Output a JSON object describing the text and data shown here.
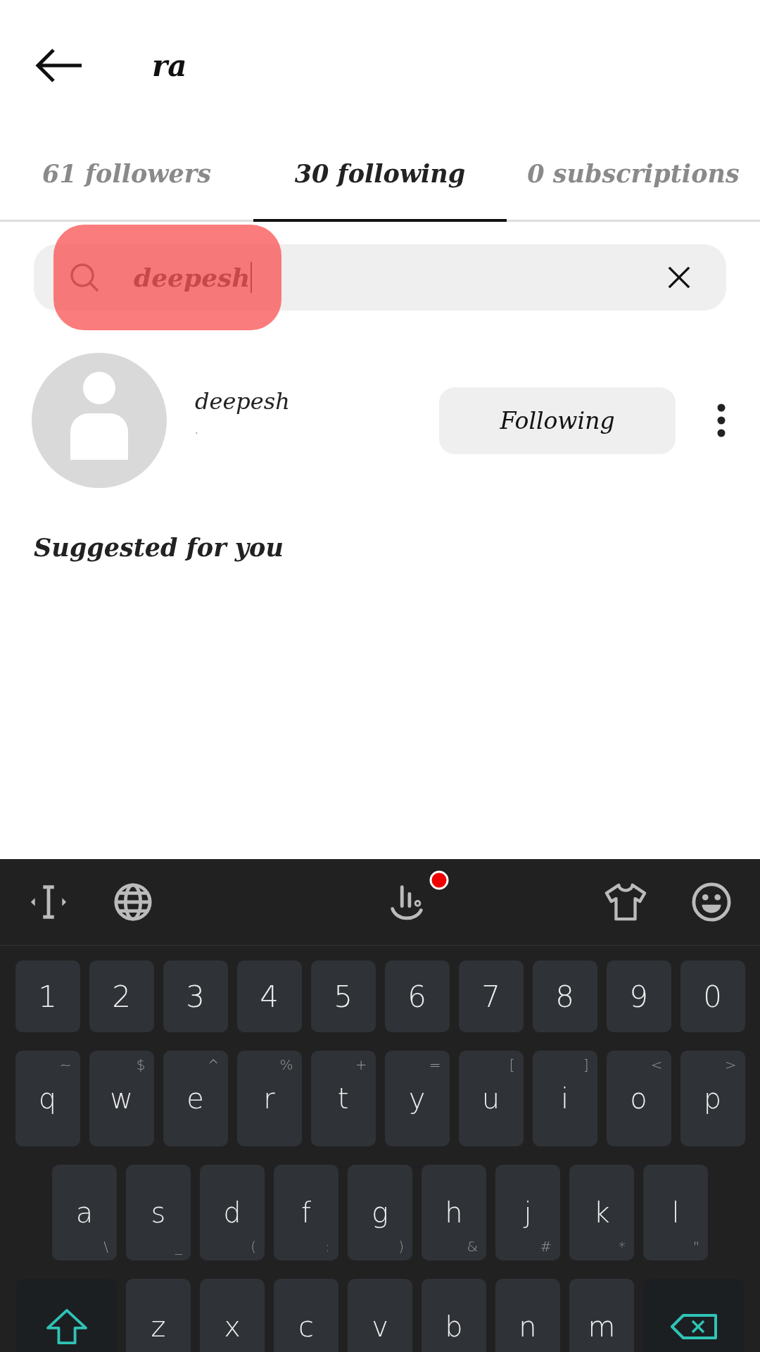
{
  "header": {
    "title": "ra"
  },
  "tabs": [
    {
      "label": "61 followers",
      "selected": false
    },
    {
      "label": "30 following",
      "selected": true
    },
    {
      "label": "0 subscriptions",
      "selected": false
    }
  ],
  "search": {
    "value": "deepesh",
    "highlighted": true
  },
  "results": [
    {
      "username": "deepesh",
      "subtitle": ".",
      "button": "Following"
    }
  ],
  "suggested": {
    "heading": "Suggested for you"
  },
  "keyboard": {
    "notification": true,
    "rows": [
      {
        "kind": "numbers",
        "keys": [
          {
            "label": "1"
          },
          {
            "label": "2"
          },
          {
            "label": "3"
          },
          {
            "label": "4"
          },
          {
            "label": "5"
          },
          {
            "label": "6"
          },
          {
            "label": "7"
          },
          {
            "label": "8"
          },
          {
            "label": "9"
          },
          {
            "label": "0"
          }
        ]
      },
      {
        "kind": "top-hints",
        "keys": [
          {
            "label": "q",
            "hint": "~"
          },
          {
            "label": "w",
            "hint": "$"
          },
          {
            "label": "e",
            "hint": "^"
          },
          {
            "label": "r",
            "hint": "%"
          },
          {
            "label": "t",
            "hint": "+"
          },
          {
            "label": "y",
            "hint": "="
          },
          {
            "label": "u",
            "hint": "["
          },
          {
            "label": "i",
            "hint": "]"
          },
          {
            "label": "o",
            "hint": "<"
          },
          {
            "label": "p",
            "hint": ">"
          }
        ]
      },
      {
        "kind": "bottom-hints",
        "keys": [
          {
            "label": "a",
            "hint": "\\"
          },
          {
            "label": "s",
            "hint": "_"
          },
          {
            "label": "d",
            "hint": "("
          },
          {
            "label": "f",
            "hint": ":"
          },
          {
            "label": "g",
            "hint": ")"
          },
          {
            "label": "h",
            "hint": "&"
          },
          {
            "label": "j",
            "hint": "#"
          },
          {
            "label": "k",
            "hint": "*"
          },
          {
            "label": "l",
            "hint": "\""
          }
        ]
      },
      {
        "kind": "bottom-hints",
        "keys": [
          {
            "kind": "shift"
          },
          {
            "label": "z"
          },
          {
            "label": "x"
          },
          {
            "label": "c"
          },
          {
            "label": "v"
          },
          {
            "label": "b"
          },
          {
            "label": "n"
          },
          {
            "label": "m"
          },
          {
            "kind": "backspace"
          }
        ]
      }
    ]
  }
}
